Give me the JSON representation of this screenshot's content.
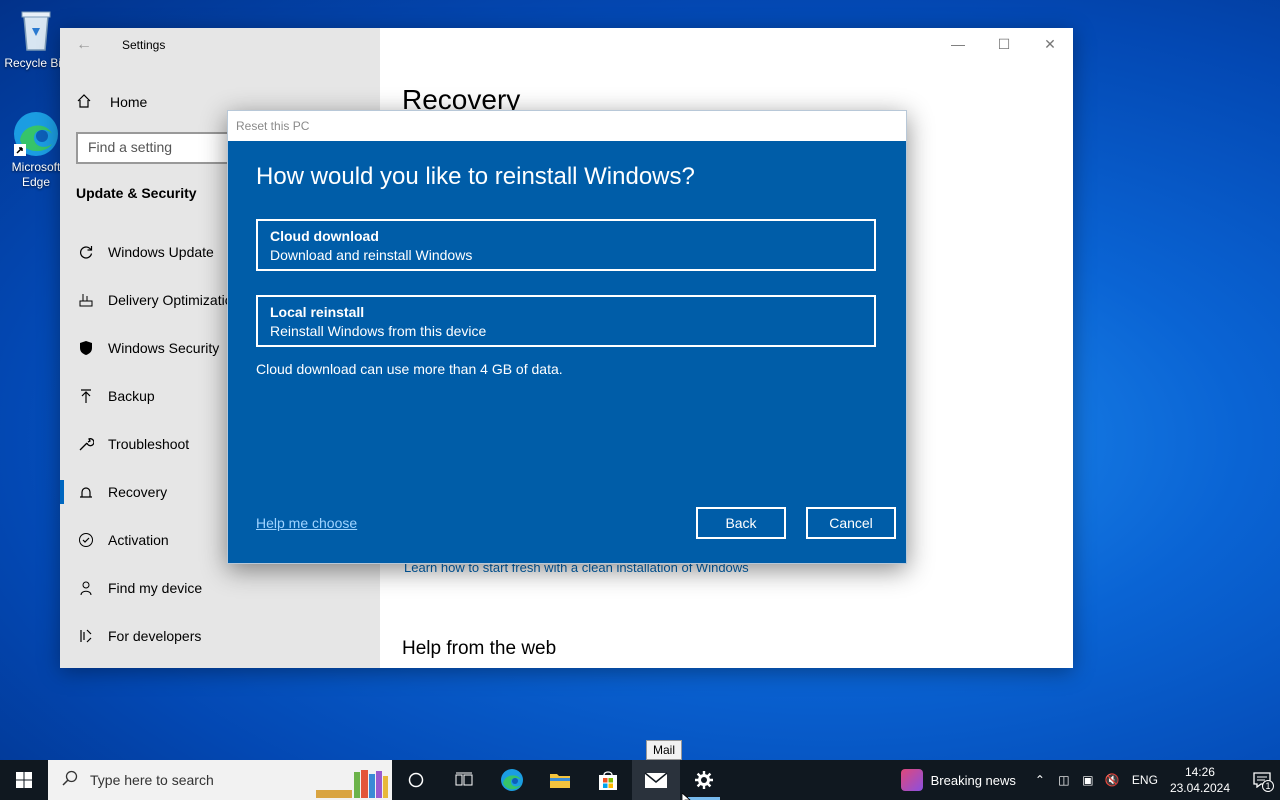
{
  "desktop": {
    "recycle_label": "Recycle Bin",
    "edge_label_1": "Microsoft",
    "edge_label_2": "Edge"
  },
  "settings": {
    "window_title": "Settings",
    "home_label": "Home",
    "search_placeholder": "Find a setting",
    "section_title": "Update & Security",
    "nav_items": [
      {
        "label": "Windows Update",
        "icon": "refresh-icon"
      },
      {
        "label": "Delivery Optimization",
        "icon": "delivery-icon"
      },
      {
        "label": "Windows Security",
        "icon": "shield-icon"
      },
      {
        "label": "Backup",
        "icon": "backup-arrow-icon"
      },
      {
        "label": "Troubleshoot",
        "icon": "wrench-icon"
      },
      {
        "label": "Recovery",
        "icon": "recovery-icon"
      },
      {
        "label": "Activation",
        "icon": "check-circle-icon"
      },
      {
        "label": "Find my device",
        "icon": "person-locate-icon"
      },
      {
        "label": "For developers",
        "icon": "developer-icon"
      }
    ],
    "active_item": "Recovery",
    "page_title": "Recovery",
    "learn_link": "Learn how to start fresh with a clean installation of Windows",
    "help_from_web": "Help from the web"
  },
  "dialog": {
    "title": "Reset this PC",
    "heading": "How would you like to reinstall Windows?",
    "options": [
      {
        "title": "Cloud download",
        "subtitle": "Download and reinstall Windows"
      },
      {
        "title": "Local reinstall",
        "subtitle": "Reinstall Windows from this device"
      }
    ],
    "note": "Cloud download can use more than 4 GB of data.",
    "help_link": "Help me choose",
    "back_button": "Back",
    "cancel_button": "Cancel"
  },
  "taskbar": {
    "search_placeholder": "Type here to search",
    "tooltip": "Mail",
    "news_label": "Breaking news",
    "language": "ENG",
    "time": "14:26",
    "date": "23.04.2024",
    "notification_count": "1"
  },
  "colors": {
    "dialog_bg": "#005da8",
    "accent": "#0067c0",
    "link": "#0063b1"
  }
}
